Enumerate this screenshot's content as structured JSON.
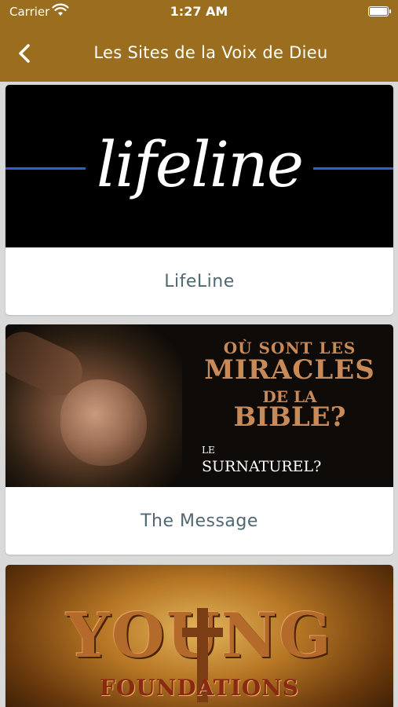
{
  "status_bar": {
    "carrier": "Carrier",
    "time": "1:27 AM",
    "wifi_icon": "wifi-icon",
    "battery_icon": "battery-icon"
  },
  "header": {
    "title": "Les Sites de la Voix de Dieu",
    "back_icon": "chevron-left-icon",
    "background_color": "#9b6d1f"
  },
  "cards": [
    {
      "label": "LifeLine",
      "image_text": "lifeline"
    },
    {
      "label": "The Message",
      "image_text": {
        "line1": "OÙ SONT LES",
        "line2": "MIRACLES",
        "line3": "DE LA",
        "line4": "BIBLE?",
        "line5": "LE",
        "line6": "SURNATUREL?"
      }
    },
    {
      "label": "",
      "image_text": {
        "line1": "YOUNG",
        "line2": "FOUNDATIONS"
      }
    }
  ],
  "colors": {
    "accent": "#9b6d1f",
    "label_text": "#4f6873",
    "lifeline_line": "#2d63c7"
  }
}
